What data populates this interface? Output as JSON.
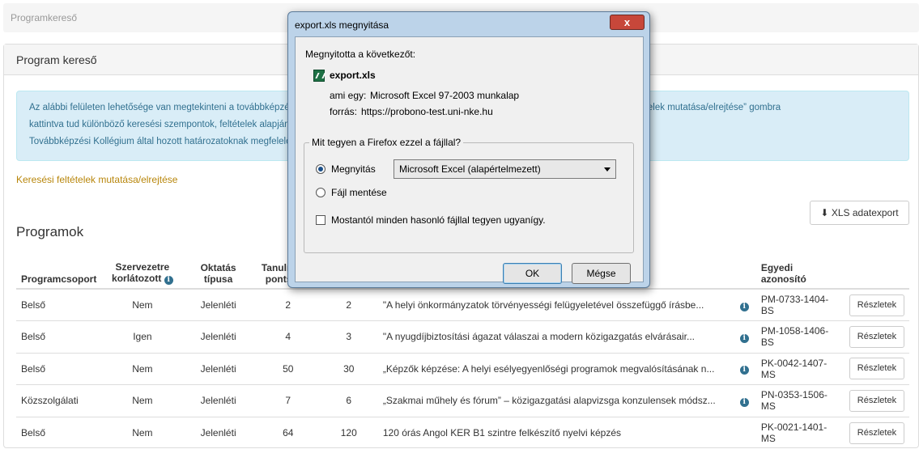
{
  "breadcrumb": "Programkereső",
  "panel": {
    "heading": "Program kereső",
    "info_lines": [
      "Az alábbi felületen lehetősége van megtekinteni a továbbképzési programok kínálatát. A keresési mezők megjelenítéséhez kattintson a „keresési feltételek mutatása/elrejtése” gombra",
      "kattintva tud különböző keresési szempontok, feltételek alapján szűrni a programok között. A felületen szereplő továbbképzések köre a Közigazgatási",
      "Továbbképzési Kollégium által hozott határozatoknak megfelelően kerül frissítésre."
    ],
    "toggle_link": "Keresési feltételek mutatása/elrejtése",
    "xls_button": "XLS adatexport",
    "section_title": "Programok"
  },
  "table": {
    "headers": {
      "group": "Programcsoport",
      "org_line1": "Szervezetre",
      "org_line2": "korlátozott",
      "type": "Oktatás típusa",
      "points_line1": "Tanulmányi",
      "points_line2": "pontszám",
      "hours": "",
      "title": "",
      "id": "Egyedi azonosító"
    },
    "details_label": "Részletek",
    "rows": [
      {
        "group": "Belső",
        "restricted": "Nem",
        "type": "Jelenléti",
        "points": "2",
        "hours": "2",
        "title": "\"A helyi önkormányzatok törvényességi felügyeletével összefüggő írásbe...",
        "has_info": true,
        "id": "PM-0733-1404-BS"
      },
      {
        "group": "Belső",
        "restricted": "Igen",
        "type": "Jelenléti",
        "points": "4",
        "hours": "3",
        "title": "\"A nyugdíjbiztosítási ágazat válaszai a modern közigazgatás elvárásair...",
        "has_info": true,
        "id": "PM-1058-1406-BS"
      },
      {
        "group": "Belső",
        "restricted": "Nem",
        "type": "Jelenléti",
        "points": "50",
        "hours": "30",
        "title": "„Képzők képzése: A helyi esélyegyenlőségi programok megvalósításának n...",
        "has_info": true,
        "id": "PK-0042-1407-MS"
      },
      {
        "group": "Közszolgálati",
        "restricted": "Nem",
        "type": "Jelenléti",
        "points": "7",
        "hours": "6",
        "title": "„Szakmai műhely és fórum” – közigazgatási alapvizsga konzulensek módsz...",
        "has_info": true,
        "id": "PN-0353-1506-MS"
      },
      {
        "group": "Belső",
        "restricted": "Nem",
        "type": "Jelenléti",
        "points": "64",
        "hours": "120",
        "title": "120 órás Angol KER B1 szintre felkészítő nyelvi képzés",
        "has_info": false,
        "id": "PK-0021-1401-MS"
      }
    ]
  },
  "dialog": {
    "title": "export.xls megnyitása",
    "close": "x",
    "opened_label": "Megnyitotta a következőt:",
    "filename": "export.xls",
    "type_label": "ami egy:",
    "type_value": "Microsoft Excel 97-2003 munkalap",
    "source_label": "forrás:",
    "source_value": "https://probono-test.uni-nke.hu",
    "group_title": "Mit tegyen a Firefox ezzel a fájllal?",
    "open_option": "Megnyitás",
    "app_select": "Microsoft Excel (alapértelmezett)",
    "save_option": "Fájl mentése",
    "remember": "Mostantól minden hasonló fájllal tegyen ugyanígy.",
    "ok": "OK",
    "cancel": "Mégse"
  }
}
